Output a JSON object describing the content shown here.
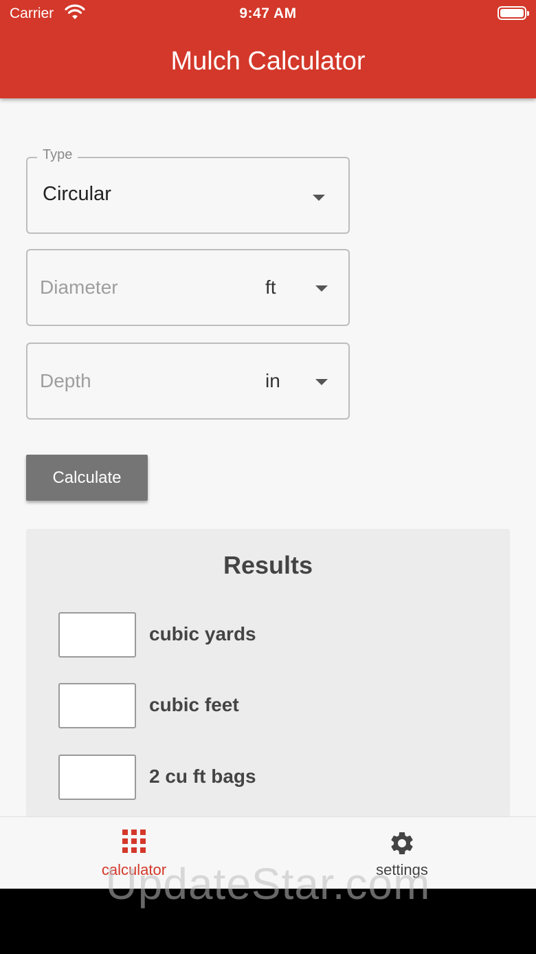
{
  "status_bar": {
    "carrier": "Carrier",
    "time": "9:47 AM"
  },
  "app_bar": {
    "title": "Mulch Calculator"
  },
  "form": {
    "type": {
      "label": "Type",
      "value": "Circular"
    },
    "diameter": {
      "placeholder": "Diameter",
      "unit": "ft"
    },
    "depth": {
      "placeholder": "Depth",
      "unit": "in"
    },
    "calculate_label": "Calculate"
  },
  "results": {
    "title": "Results",
    "rows": [
      {
        "label": "cubic yards",
        "value": ""
      },
      {
        "label": "cubic feet",
        "value": ""
      },
      {
        "label": "2 cu ft bags",
        "value": ""
      }
    ]
  },
  "tabs": [
    {
      "label": "calculator",
      "icon": "grid-icon",
      "active": true,
      "color": "#d3382a"
    },
    {
      "label": "settings",
      "icon": "gear-icon",
      "active": false,
      "color": "#444444"
    }
  ],
  "watermark": "UpdateStar.com",
  "colors": {
    "accent": "#d3382a",
    "button": "#757575",
    "results_bg": "#ececec"
  }
}
